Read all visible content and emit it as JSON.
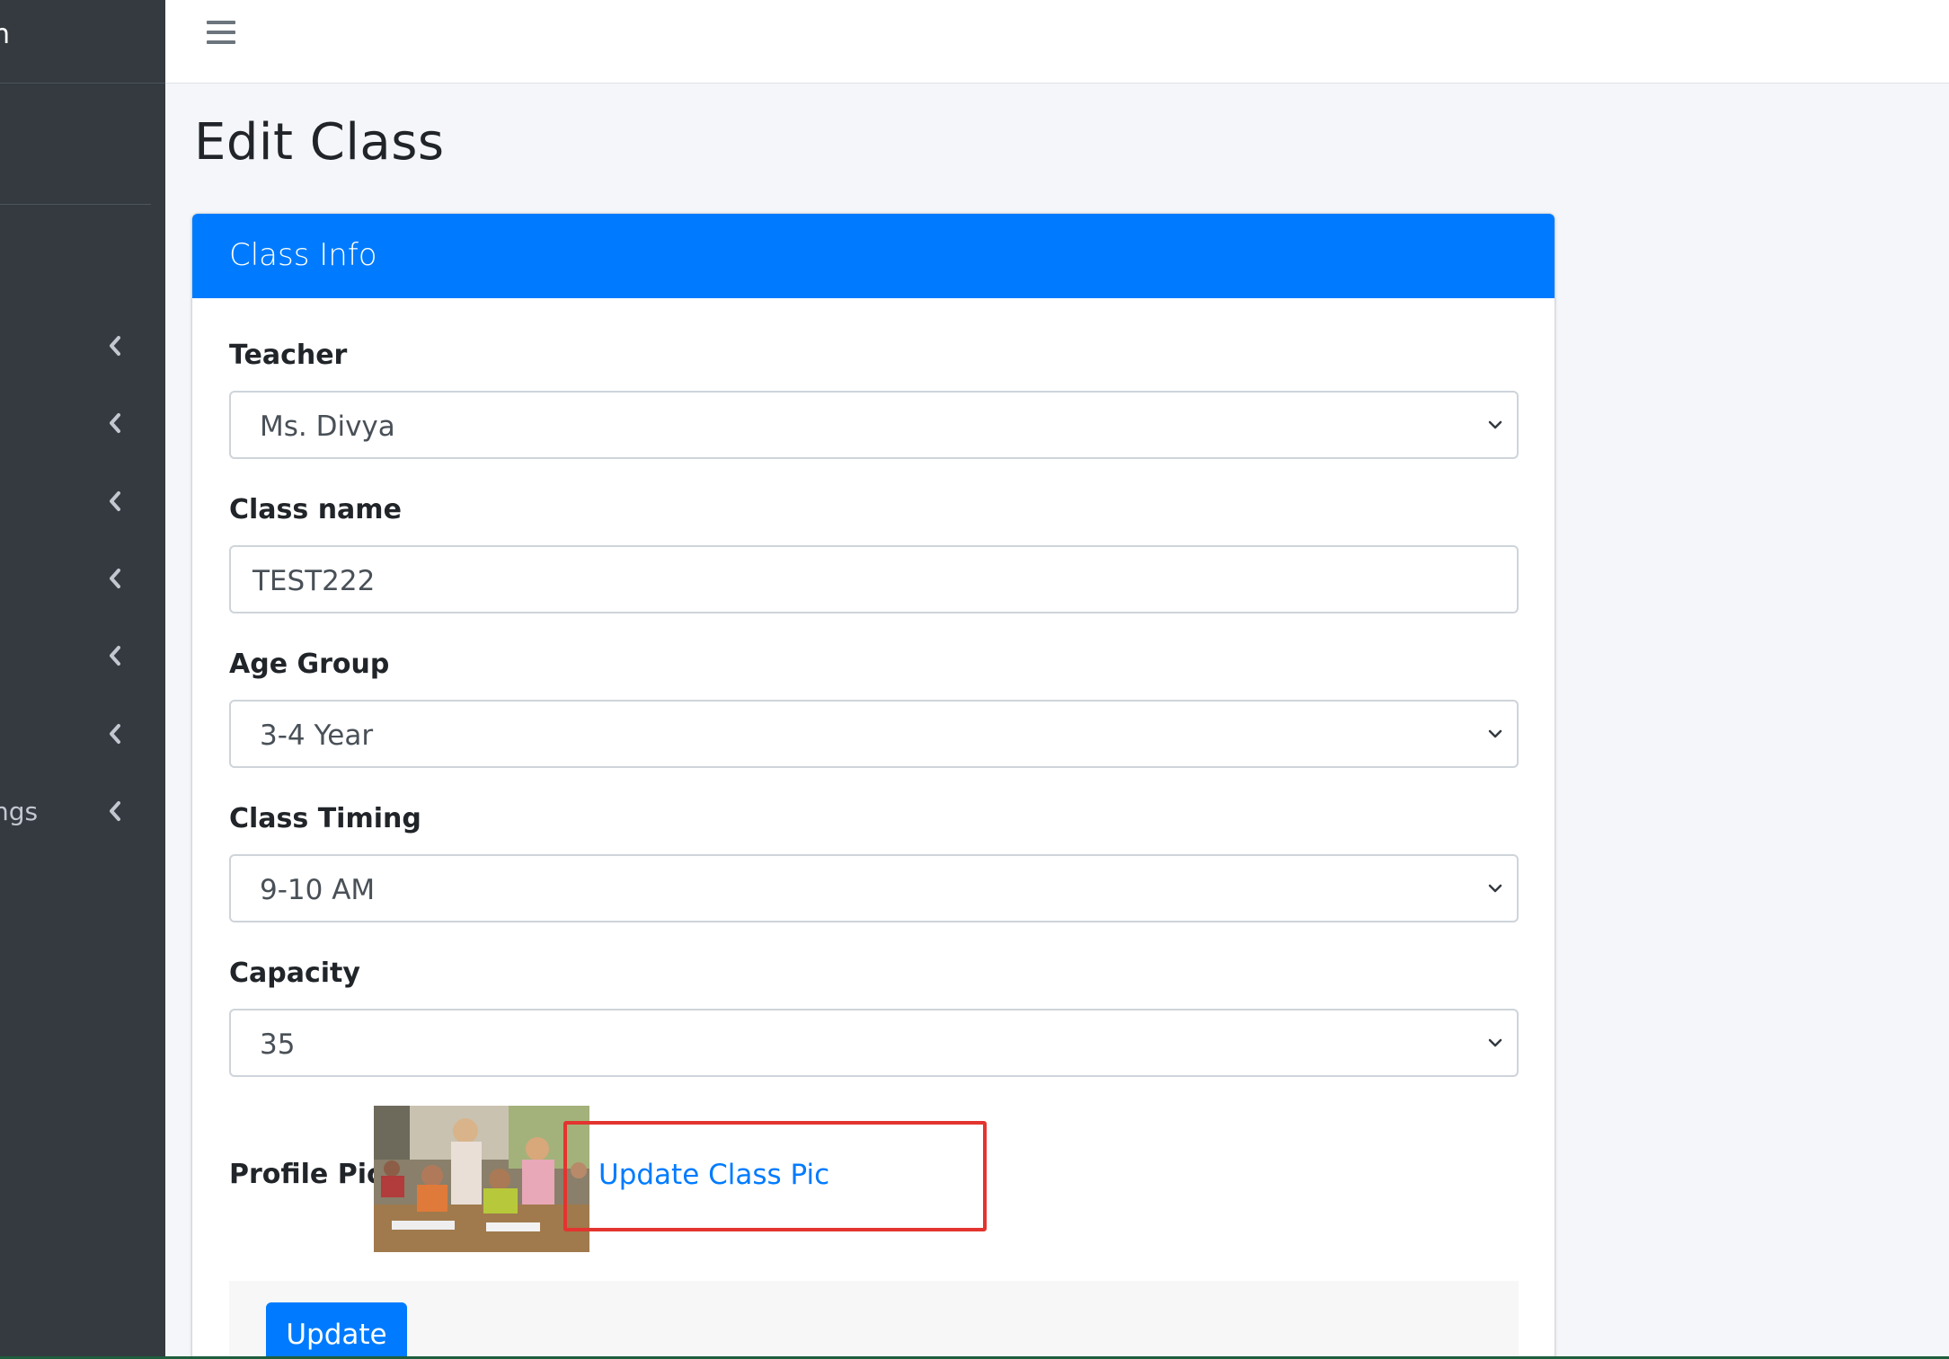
{
  "sidebar": {
    "brand_fragment": "n",
    "nav_items": [
      {
        "label": ""
      },
      {
        "label": ""
      },
      {
        "label": ""
      },
      {
        "label": ""
      },
      {
        "label": ""
      },
      {
        "label": ""
      },
      {
        "label": "ngs"
      }
    ],
    "chevron_icon": "chevron-left-icon"
  },
  "topbar": {
    "menu_icon": "hamburger-menu-icon"
  },
  "page": {
    "title": "Edit Class"
  },
  "card": {
    "header": "Class Info",
    "fields": {
      "teacher": {
        "label": "Teacher",
        "value": "Ms. Divya"
      },
      "class_name": {
        "label": "Class name",
        "value": "TEST222"
      },
      "age_group": {
        "label": "Age Group",
        "value": "3-4 Year"
      },
      "class_timing": {
        "label": "Class Timing",
        "value": "9-10 AM"
      },
      "capacity": {
        "label": "Capacity",
        "value": "35"
      }
    },
    "profile_pic": {
      "label": "Profile Pic",
      "link_text": "Update Class Pic"
    },
    "submit_label": "Update"
  },
  "colors": {
    "primary": "#007bff",
    "sidebar_bg": "#343a40",
    "highlight_border": "#e3342f",
    "page_bg": "#f4f6f9"
  }
}
